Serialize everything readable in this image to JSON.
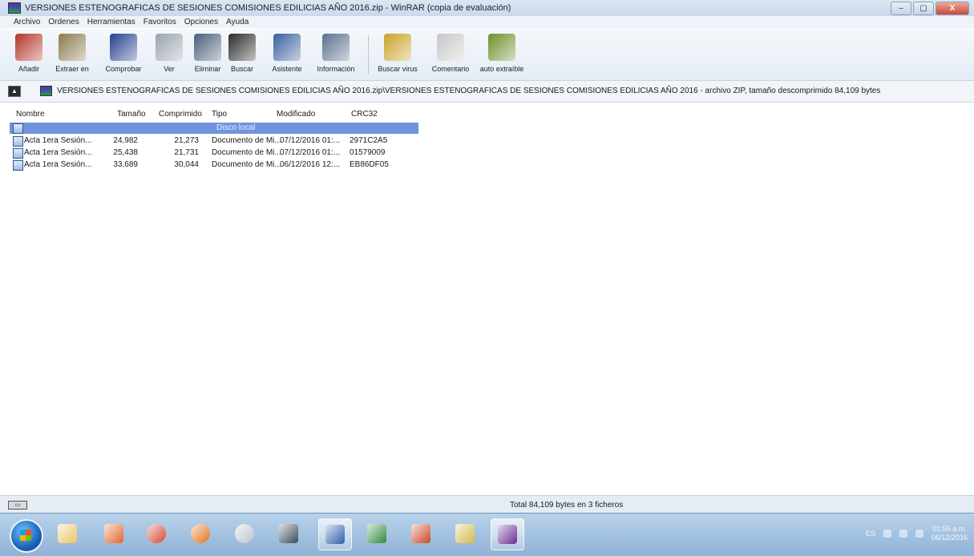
{
  "window": {
    "title": "VERSIONES ESTENOGRAFICAS DE SESIONES COMISIONES EDILICIAS AÑO 2016.zip - WinRAR (copia de evaluación)",
    "controls": {
      "minimize": "–",
      "maximize": "▢",
      "close": "X"
    }
  },
  "menu": [
    "Archivo",
    "Ordenes",
    "Herramientas",
    "Favoritos",
    "Opciones",
    "Ayuda"
  ],
  "toolbar": [
    {
      "label": "Añadir",
      "icon": "add-archive-icon",
      "color": "#b5342a"
    },
    {
      "label": "Extraer en",
      "icon": "extract-to-icon",
      "color": "#8c7a4e"
    },
    {
      "label": "Comprobar",
      "icon": "test-icon",
      "color": "#27408f"
    },
    {
      "label": "Ver",
      "icon": "view-icon",
      "color": "#9aa3ad"
    },
    {
      "label": "Eliminar",
      "icon": "delete-icon",
      "color": "#4a5f7a"
    },
    {
      "label": "Buscar",
      "icon": "find-binoculars-icon",
      "color": "#2b2b2b"
    },
    {
      "label": "Asistente",
      "icon": "wizard-icon",
      "color": "#3b5f9e"
    },
    {
      "label": "Información",
      "icon": "info-icon",
      "color": "#5a6f8f"
    },
    {
      "label": "Buscar virus",
      "icon": "virus-scan-icon",
      "color": "#c9a227"
    },
    {
      "label": "Comentario",
      "icon": "comment-icon",
      "color": "#c7c7c7"
    },
    {
      "label": "auto extraíble",
      "icon": "sfx-icon",
      "color": "#6c8f2a"
    }
  ],
  "address": {
    "path": "VERSIONES ESTENOGRAFICAS DE SESIONES COMISIONES EDILICIAS AÑO 2016.zip\\VERSIONES ESTENOGRAFICAS DE SESIONES COMISIONES EDILICIAS AÑO 2016 - archivo ZIP, tamaño descomprimido 84,109 bytes"
  },
  "columns": {
    "name": "Nombre",
    "size": "Tamaño",
    "packed": "Comprimido",
    "type": "Tipo",
    "modified": "Modificado",
    "crc": "CRC32"
  },
  "parent_row": {
    "type": "Disco local"
  },
  "files": [
    {
      "name": "Acta 1era Sesión...",
      "size": "24,982",
      "packed": "21,273",
      "type": "Documento de Mi...",
      "modified": "07/12/2016 01:...",
      "crc": "2971C2A5"
    },
    {
      "name": "Acta 1era Sesión...",
      "size": "25,438",
      "packed": "21,731",
      "type": "Documento de Mi...",
      "modified": "07/12/2016 01:...",
      "crc": "01579009"
    },
    {
      "name": "Acta 1era Sesión...",
      "size": "33,689",
      "packed": "30,044",
      "type": "Documento de Mi...",
      "modified": "06/12/2016 12:...",
      "crc": "EB86DF05"
    }
  ],
  "status": {
    "summary": "Total 84,109 bytes en 3 ficheros"
  },
  "taskbar": {
    "apps": [
      {
        "name": "explorer",
        "icon": "folder-icon",
        "color": "#e8c565"
      },
      {
        "name": "media",
        "icon": "media-player-icon",
        "color": "#e0662b"
      },
      {
        "name": "chrome",
        "icon": "chrome-icon",
        "color": "#d8452f"
      },
      {
        "name": "firefox",
        "icon": "firefox-icon",
        "color": "#e3731c"
      },
      {
        "name": "webcam",
        "icon": "webcam-icon",
        "color": "#b8c4d0"
      },
      {
        "name": "printer",
        "icon": "printer-icon",
        "color": "#3c4a5a"
      },
      {
        "name": "word",
        "icon": "word-icon",
        "color": "#2c5faa"
      },
      {
        "name": "excel",
        "icon": "excel-icon",
        "color": "#2f8a3a"
      },
      {
        "name": "powerpoint",
        "icon": "powerpoint-icon",
        "color": "#c94a2a"
      },
      {
        "name": "folder2",
        "icon": "folder-sync-icon",
        "color": "#d4b84a"
      },
      {
        "name": "winrar",
        "icon": "winrar-icon",
        "color": "#6b2a8f"
      }
    ],
    "clock": {
      "time": "01:55 a.m.",
      "date": "06/12/2016"
    },
    "tray_lang": "ES"
  }
}
